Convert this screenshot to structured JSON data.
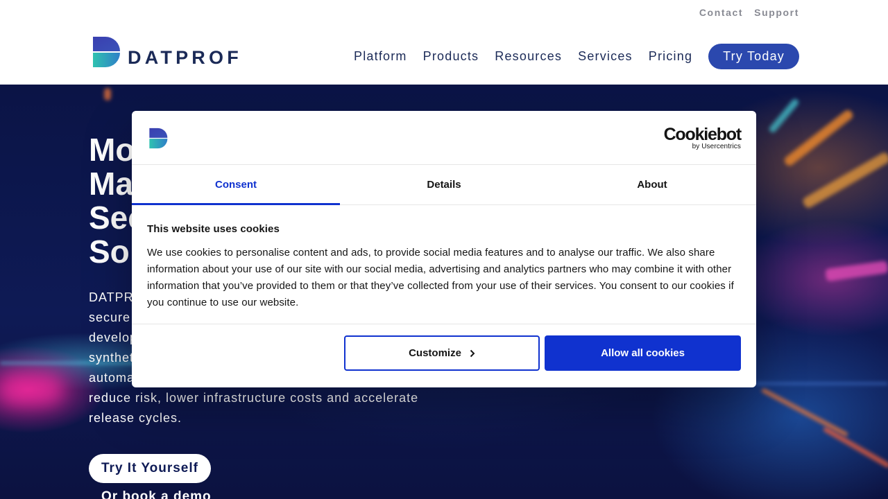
{
  "header": {
    "utility_links": [
      "Contact",
      "Support"
    ],
    "logo_text": "DATPROF",
    "nav": [
      "Platform",
      "Products",
      "Resources",
      "Services",
      "Pricing"
    ],
    "cta_label": "Try Today"
  },
  "hero": {
    "title_lines": [
      "Mo",
      "Ma",
      "Sec",
      "So"
    ],
    "desc_lines": [
      "DATPR",
      "secure",
      "develop",
      "synthet",
      "automa",
      "reduce risk, lower infrastructure costs and accelerate",
      "release cycles."
    ],
    "cta_label": "Try It Yourself",
    "demo_link": "Or book a demo"
  },
  "cookie_dialog": {
    "brand": "Cookiebot",
    "brand_sub": "by Usercentrics",
    "tabs": [
      "Consent",
      "Details",
      "About"
    ],
    "active_tab": "Consent",
    "heading": "This website uses cookies",
    "body": "We use cookies to personalise content and ads, to provide social media features and to analyse our traffic. We also share information about your use of our site with our social media, advertising and analytics partners who may combine it with other information that you’ve provided to them or that they’ve collected from your use of their services. You consent to our cookies if you continue to use our website.",
    "customize_label": "Customize",
    "allow_label": "Allow all cookies"
  },
  "colors": {
    "brand_navy": "#1b2a57",
    "brand_blue": "#2b48ae",
    "cookiebot_blue": "#1032cf",
    "logo_gradient": [
      "#2f4bb0",
      "#2fb7a8"
    ]
  },
  "icons": [
    "datprof-logo-icon",
    "chevron-right-icon"
  ]
}
